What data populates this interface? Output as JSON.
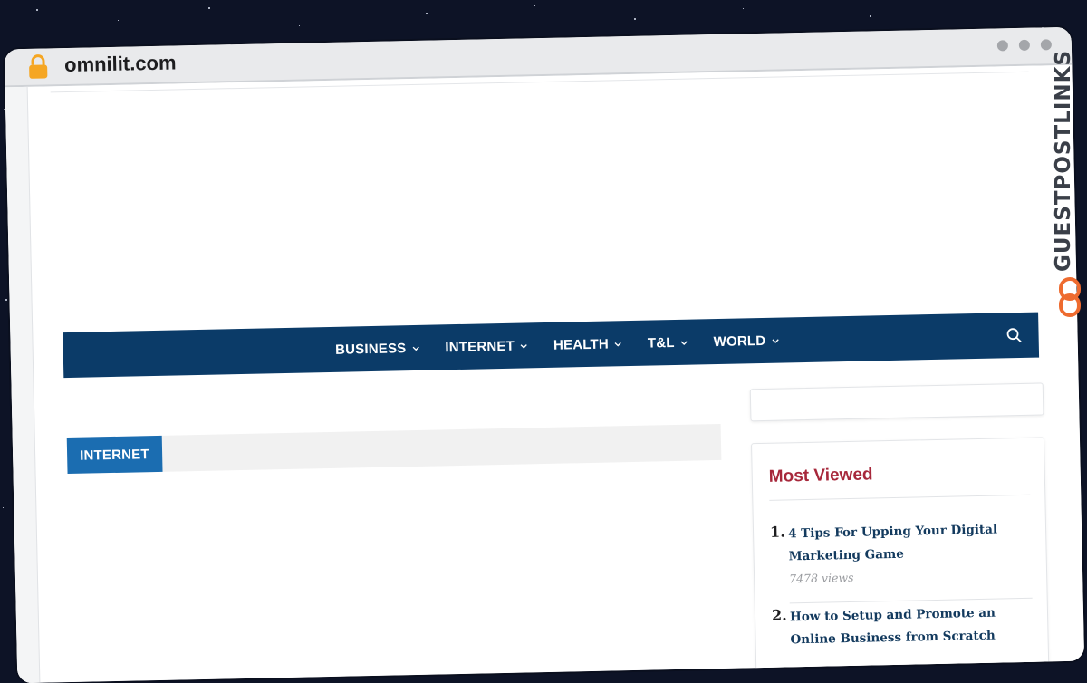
{
  "browser": {
    "url": "omnilit.com",
    "lock_icon": "lock-icon"
  },
  "nav": {
    "items": [
      {
        "label": "BUSINESS"
      },
      {
        "label": "INTERNET"
      },
      {
        "label": "HEALTH"
      },
      {
        "label": "T&L"
      },
      {
        "label": "WORLD"
      }
    ],
    "search_icon": "search-icon",
    "background": "#0b3b68"
  },
  "section": {
    "tag": "INTERNET",
    "tag_color": "#1b6db1"
  },
  "most_viewed": {
    "title": "Most Viewed",
    "title_color": "#a7283b",
    "items": [
      {
        "num": "1.",
        "title": "4 Tips For Upping Your Digital Marketing Game",
        "views": "7478 views"
      },
      {
        "num": "2.",
        "title": "How to Setup and Promote an Online Business from Scratch"
      }
    ]
  },
  "watermark": {
    "text": "GUESTPOSTLINKS",
    "accent": "#ee6b2f"
  }
}
